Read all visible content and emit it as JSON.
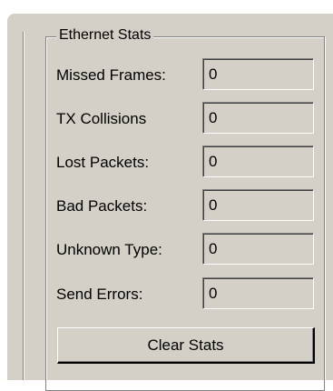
{
  "group_title": "Ethernet Stats",
  "stats": [
    {
      "label": "Missed Frames:",
      "value": "0"
    },
    {
      "label": "TX Collisions",
      "value": "0"
    },
    {
      "label": "Lost Packets:",
      "value": "0"
    },
    {
      "label": "Bad Packets:",
      "value": "0"
    },
    {
      "label": "Unknown Type:",
      "value": "0"
    },
    {
      "label": "Send Errors:",
      "value": "0"
    }
  ],
  "clear_button_label": "Clear Stats"
}
